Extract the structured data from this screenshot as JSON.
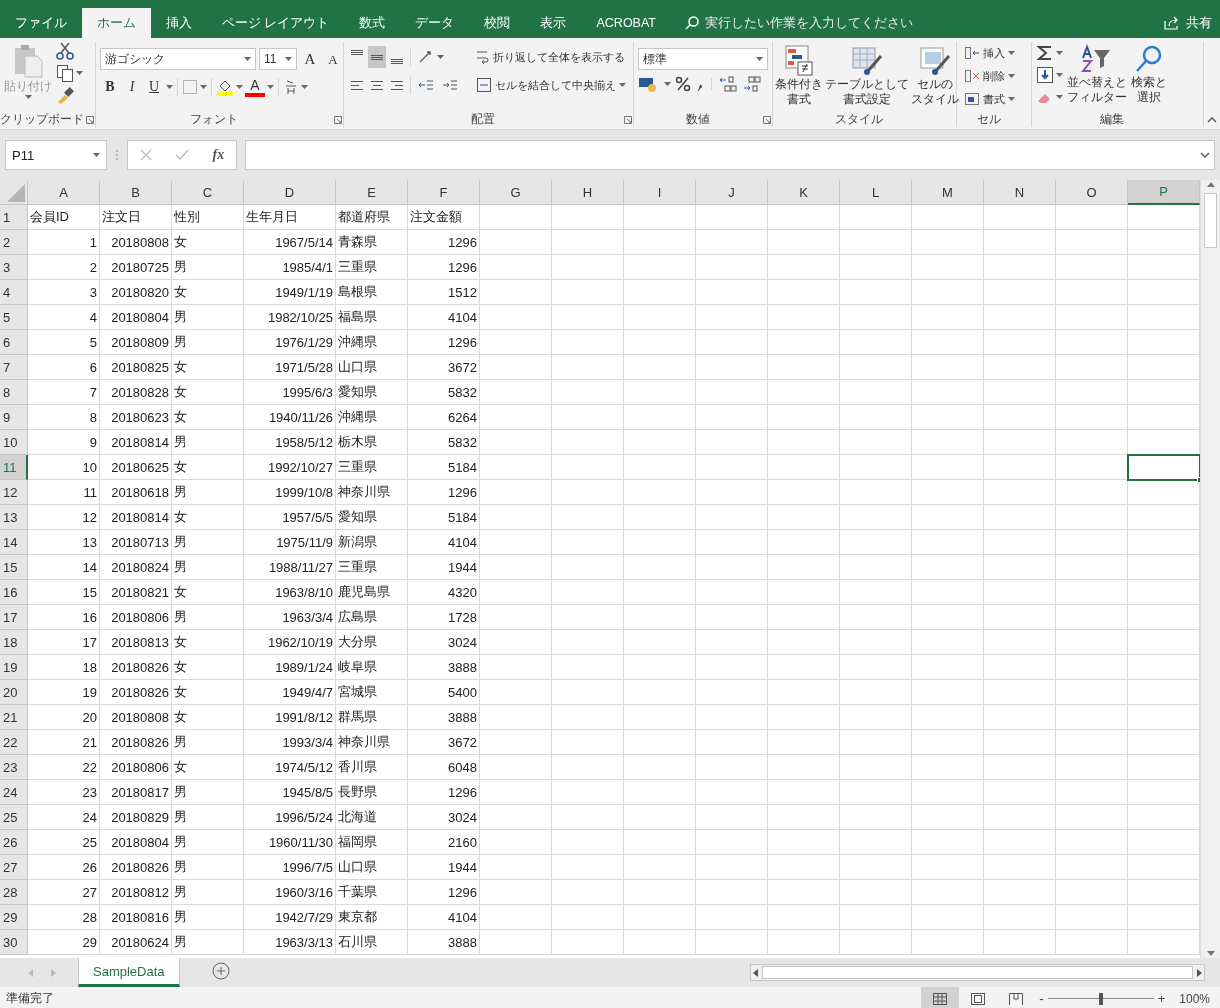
{
  "ribbon_tabs": [
    {
      "label": "ファイル",
      "selected": false
    },
    {
      "label": "ホーム",
      "selected": true
    },
    {
      "label": "挿入",
      "selected": false
    },
    {
      "label": "ページ レイアウト",
      "selected": false
    },
    {
      "label": "数式",
      "selected": false
    },
    {
      "label": "データ",
      "selected": false
    },
    {
      "label": "校閲",
      "selected": false
    },
    {
      "label": "表示",
      "selected": false
    },
    {
      "label": "ACROBAT",
      "selected": false
    }
  ],
  "tell_me": {
    "placeholder": "実行したい作業を入力してください"
  },
  "share": "共有",
  "ribbon": {
    "clipboard": {
      "paste": "貼り付け",
      "label": "クリップボード"
    },
    "font": {
      "name": "游ゴシック",
      "size": "11",
      "grow": "A",
      "shrink": "A",
      "bold": "B",
      "italic": "I",
      "underline": "U",
      "font_color": "A",
      "label": "フォント"
    },
    "alignment": {
      "vertical": [
        {
          "selected": false
        },
        {
          "selected": true
        },
        {
          "selected": false
        }
      ],
      "wrap": "折り返して全体を表示する",
      "merge": "セルを結合して中央揃え",
      "label": "配置"
    },
    "number": {
      "format": "標準",
      "label": "数値"
    },
    "styles": {
      "buttons": [
        {
          "lines": [
            "条件付き",
            "書式"
          ]
        },
        {
          "lines": [
            "テーブルとして",
            "書式設定"
          ]
        },
        {
          "lines": [
            "セルの",
            "スタイル"
          ]
        }
      ],
      "label": "スタイル"
    },
    "cells": {
      "buttons": [
        "挿入",
        "削除",
        "書式"
      ],
      "label": "セル"
    },
    "editing": {
      "buttons": [
        {
          "lines": [
            "並べ替えと",
            "フィルター"
          ]
        },
        {
          "lines": [
            "検索と",
            "選択"
          ]
        }
      ],
      "label": "編集"
    }
  },
  "formula_bar": {
    "name_box": "P11",
    "fx": "fx"
  },
  "sheet": {
    "columns": [
      {
        "label": "A",
        "selected": false
      },
      {
        "label": "B",
        "selected": false
      },
      {
        "label": "C",
        "selected": false
      },
      {
        "label": "D",
        "selected": false
      },
      {
        "label": "E",
        "selected": false
      },
      {
        "label": "F",
        "selected": false
      },
      {
        "label": "G",
        "selected": false
      },
      {
        "label": "H",
        "selected": false
      },
      {
        "label": "I",
        "selected": false
      },
      {
        "label": "J",
        "selected": false
      },
      {
        "label": "K",
        "selected": false
      },
      {
        "label": "L",
        "selected": false
      },
      {
        "label": "M",
        "selected": false
      },
      {
        "label": "N",
        "selected": false
      },
      {
        "label": "O",
        "selected": false
      },
      {
        "label": "P",
        "selected": true
      }
    ],
    "rows": [
      {
        "number": "1",
        "kind": "header",
        "selected": false,
        "cells": [
          "会員ID",
          "注文日",
          "性別",
          "生年月日",
          "都道府県",
          "注文金額"
        ]
      },
      {
        "number": "2",
        "kind": "record",
        "selected": false,
        "cells": [
          "1",
          "20180808",
          "女",
          "1967/5/14",
          "青森県",
          "1296"
        ]
      },
      {
        "number": "3",
        "kind": "record",
        "selected": false,
        "cells": [
          "2",
          "20180725",
          "男",
          "1985/4/1",
          "三重県",
          "1296"
        ]
      },
      {
        "number": "4",
        "kind": "record",
        "selected": false,
        "cells": [
          "3",
          "20180820",
          "女",
          "1949/1/19",
          "島根県",
          "1512"
        ]
      },
      {
        "number": "5",
        "kind": "record",
        "selected": false,
        "cells": [
          "4",
          "20180804",
          "男",
          "1982/10/25",
          "福島県",
          "4104"
        ]
      },
      {
        "number": "6",
        "kind": "record",
        "selected": false,
        "cells": [
          "5",
          "20180809",
          "男",
          "1976/1/29",
          "沖縄県",
          "1296"
        ]
      },
      {
        "number": "7",
        "kind": "record",
        "selected": false,
        "cells": [
          "6",
          "20180825",
          "女",
          "1971/5/28",
          "山口県",
          "3672"
        ]
      },
      {
        "number": "8",
        "kind": "record",
        "selected": false,
        "cells": [
          "7",
          "20180828",
          "女",
          "1995/6/3",
          "愛知県",
          "5832"
        ]
      },
      {
        "number": "9",
        "kind": "record",
        "selected": false,
        "cells": [
          "8",
          "20180623",
          "女",
          "1940/11/26",
          "沖縄県",
          "6264"
        ]
      },
      {
        "number": "10",
        "kind": "record",
        "selected": false,
        "cells": [
          "9",
          "20180814",
          "男",
          "1958/5/12",
          "栃木県",
          "5832"
        ]
      },
      {
        "number": "11",
        "kind": "record",
        "selected": true,
        "cells": [
          "10",
          "20180625",
          "女",
          "1992/10/27",
          "三重県",
          "5184"
        ]
      },
      {
        "number": "12",
        "kind": "record",
        "selected": false,
        "cells": [
          "11",
          "20180618",
          "男",
          "1999/10/8",
          "神奈川県",
          "1296"
        ]
      },
      {
        "number": "13",
        "kind": "record",
        "selected": false,
        "cells": [
          "12",
          "20180814",
          "女",
          "1957/5/5",
          "愛知県",
          "5184"
        ]
      },
      {
        "number": "14",
        "kind": "record",
        "selected": false,
        "cells": [
          "13",
          "20180713",
          "男",
          "1975/11/9",
          "新潟県",
          "4104"
        ]
      },
      {
        "number": "15",
        "kind": "record",
        "selected": false,
        "cells": [
          "14",
          "20180824",
          "男",
          "1988/11/27",
          "三重県",
          "1944"
        ]
      },
      {
        "number": "16",
        "kind": "record",
        "selected": false,
        "cells": [
          "15",
          "20180821",
          "女",
          "1963/8/10",
          "鹿児島県",
          "4320"
        ]
      },
      {
        "number": "17",
        "kind": "record",
        "selected": false,
        "cells": [
          "16",
          "20180806",
          "男",
          "1963/3/4",
          "広島県",
          "1728"
        ]
      },
      {
        "number": "18",
        "kind": "record",
        "selected": false,
        "cells": [
          "17",
          "20180813",
          "女",
          "1962/10/19",
          "大分県",
          "3024"
        ]
      },
      {
        "number": "19",
        "kind": "record",
        "selected": false,
        "cells": [
          "18",
          "20180826",
          "女",
          "1989/1/24",
          "岐阜県",
          "3888"
        ]
      },
      {
        "number": "20",
        "kind": "record",
        "selected": false,
        "cells": [
          "19",
          "20180826",
          "女",
          "1949/4/7",
          "宮城県",
          "5400"
        ]
      },
      {
        "number": "21",
        "kind": "record",
        "selected": false,
        "cells": [
          "20",
          "20180808",
          "女",
          "1991/8/12",
          "群馬県",
          "3888"
        ]
      },
      {
        "number": "22",
        "kind": "record",
        "selected": false,
        "cells": [
          "21",
          "20180826",
          "男",
          "1993/3/4",
          "神奈川県",
          "3672"
        ]
      },
      {
        "number": "23",
        "kind": "record",
        "selected": false,
        "cells": [
          "22",
          "20180806",
          "女",
          "1974/5/12",
          "香川県",
          "6048"
        ]
      },
      {
        "number": "24",
        "kind": "record",
        "selected": false,
        "cells": [
          "23",
          "20180817",
          "男",
          "1945/8/5",
          "長野県",
          "1296"
        ]
      },
      {
        "number": "25",
        "kind": "record",
        "selected": false,
        "cells": [
          "24",
          "20180829",
          "男",
          "1996/5/24",
          "北海道",
          "3024"
        ]
      },
      {
        "number": "26",
        "kind": "record",
        "selected": false,
        "cells": [
          "25",
          "20180804",
          "男",
          "1960/11/30",
          "福岡県",
          "2160"
        ]
      },
      {
        "number": "27",
        "kind": "record",
        "selected": false,
        "cells": [
          "26",
          "20180826",
          "男",
          "1996/7/5",
          "山口県",
          "1944"
        ]
      },
      {
        "number": "28",
        "kind": "record",
        "selected": false,
        "cells": [
          "27",
          "20180812",
          "男",
          "1960/3/16",
          "千葉県",
          "1296"
        ]
      },
      {
        "number": "29",
        "kind": "record",
        "selected": false,
        "cells": [
          "28",
          "20180816",
          "男",
          "1942/7/29",
          "東京都",
          "4104"
        ]
      },
      {
        "number": "30",
        "kind": "record",
        "selected": false,
        "cells": [
          "29",
          "20180624",
          "男",
          "1963/3/13",
          "石川県",
          "3888"
        ]
      }
    ]
  },
  "sheet_tabs": [
    {
      "label": "SampleData",
      "selected": true
    }
  ],
  "status_bar": {
    "status": "準備完了",
    "zoom_out": "-",
    "zoom_in": "+",
    "zoom": "100%",
    "level": 0.5
  }
}
